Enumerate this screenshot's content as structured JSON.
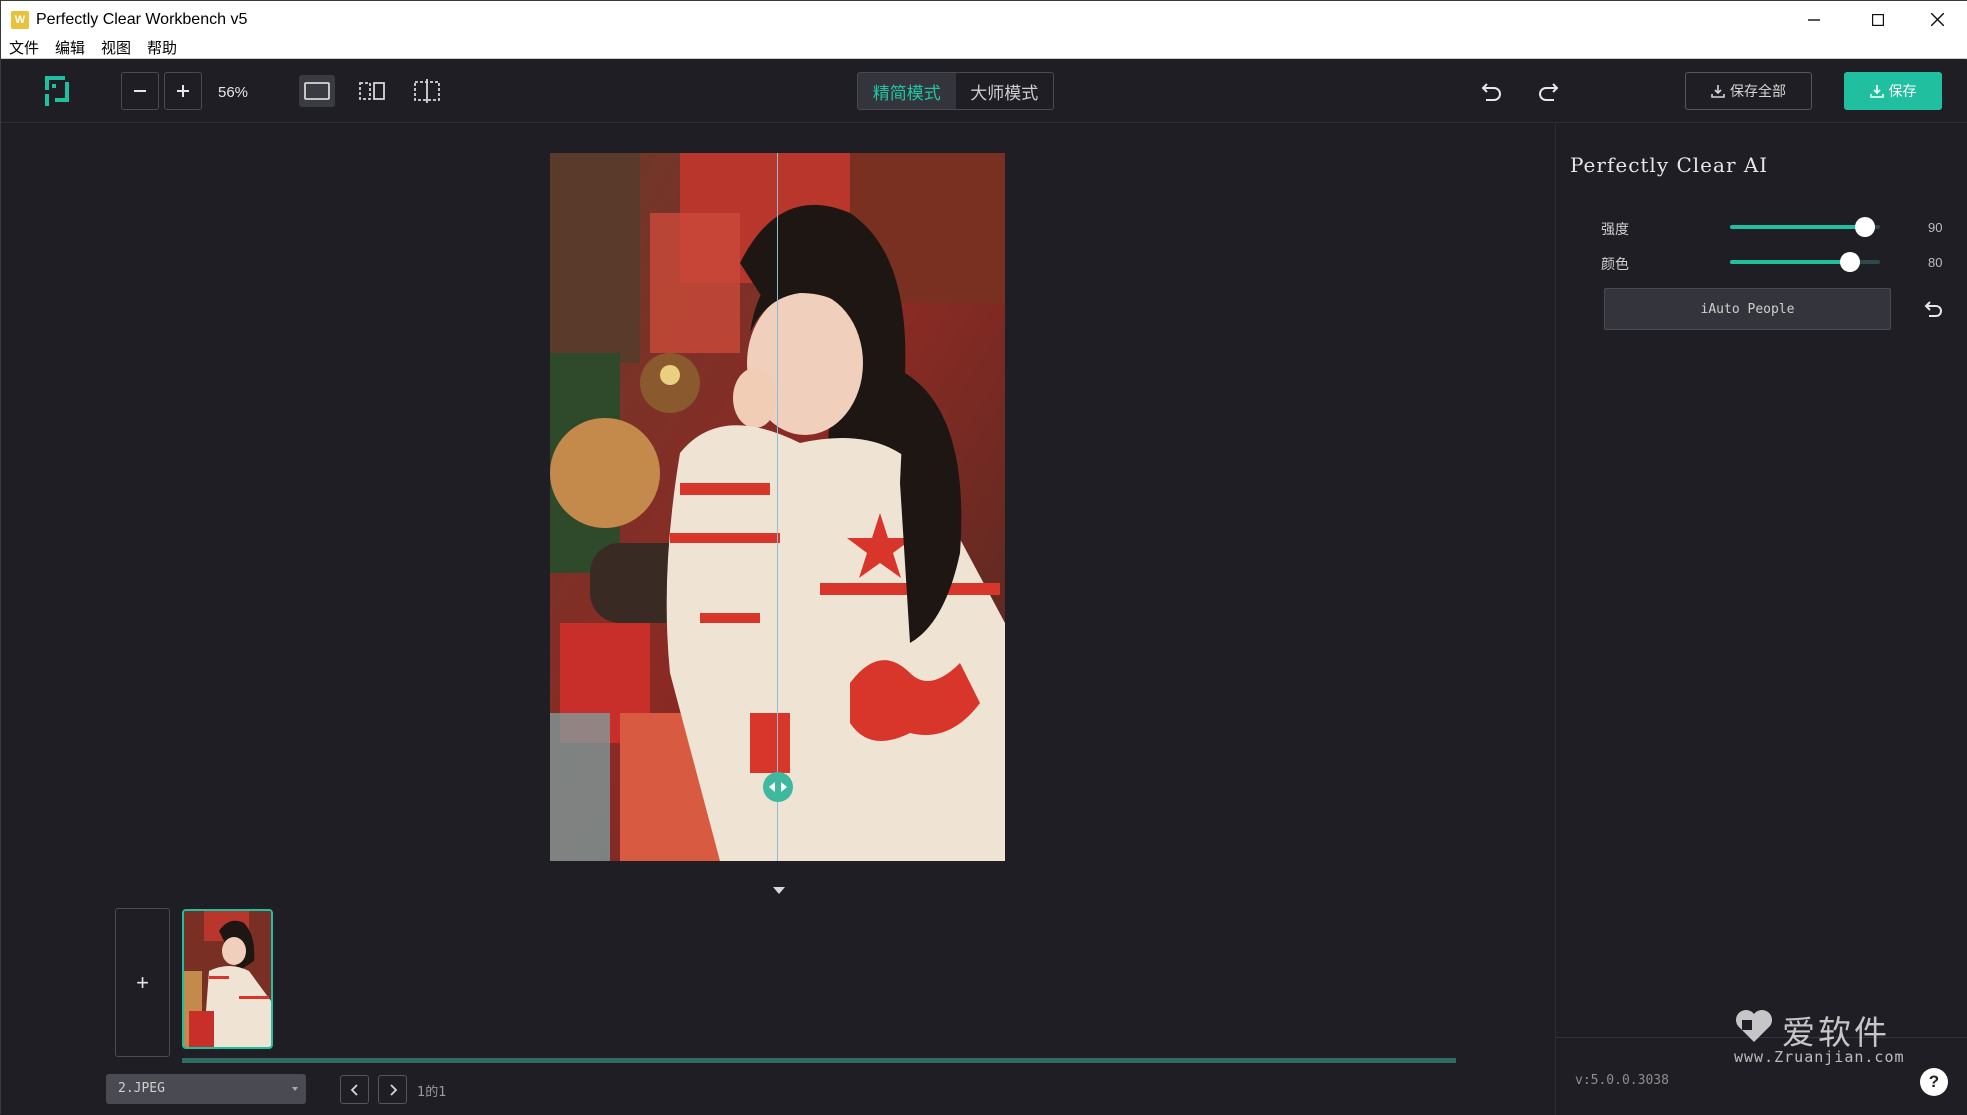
{
  "window": {
    "title": "Perfectly Clear Workbench v5",
    "app_icon_label": "W"
  },
  "menu": [
    "文件",
    "编辑",
    "视图",
    "帮助"
  ],
  "toolbar": {
    "zoom_label": "56%",
    "modes": [
      "精简模式",
      "大师模式"
    ],
    "active_mode": "精简模式",
    "save_all_label": "保存全部",
    "save_label": "保存"
  },
  "panel": {
    "title": "Perfectly Clear AI",
    "sliders": [
      {
        "label": "强度",
        "value": 90
      },
      {
        "label": "颜色",
        "value": 80
      }
    ],
    "preset_label": "iAuto People",
    "version": "v:5.0.0.3038",
    "help_label": "?"
  },
  "filmstrip": {
    "add_label": "+",
    "format": "2.JPEG",
    "page_label": "1的1"
  },
  "watermark": {
    "text": "爱软件",
    "url": "www.Zruanjian.com"
  },
  "colors": {
    "accent": "#1fbfa0",
    "background": "#1f1e24",
    "toolbar_border": "#4a4a52"
  },
  "icons": [
    "logo-icon",
    "minus-icon",
    "plus-icon",
    "single-view-icon",
    "split-view-icon",
    "crop-view-icon",
    "undo-icon",
    "redo-icon",
    "download-icon",
    "reset-icon",
    "chevron-left-icon",
    "chevron-right-icon",
    "split-handle-icon"
  ]
}
